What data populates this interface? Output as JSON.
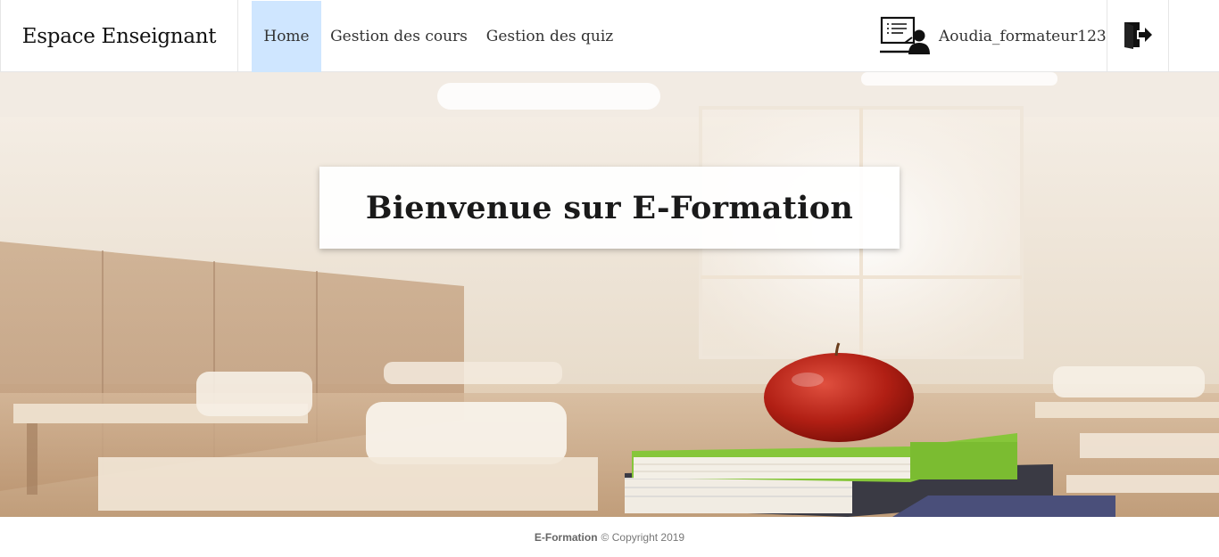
{
  "navbar": {
    "brand": "Espace Enseignant",
    "links": [
      {
        "label": "Home",
        "active": true
      },
      {
        "label": "Gestion des cours",
        "active": false
      },
      {
        "label": "Gestion des quiz",
        "active": false
      }
    ],
    "user": {
      "name": "Aoudia_formateur123",
      "icon": "teacher-icon"
    },
    "logout_icon": "logout-icon",
    "active_color": "#cfe6ff"
  },
  "hero": {
    "title": "Bienvenue sur E-Formation",
    "image": "classroom-apple-books"
  },
  "footer": {
    "brand": "E-Formation",
    "copyright": "© Copyright 2019"
  }
}
